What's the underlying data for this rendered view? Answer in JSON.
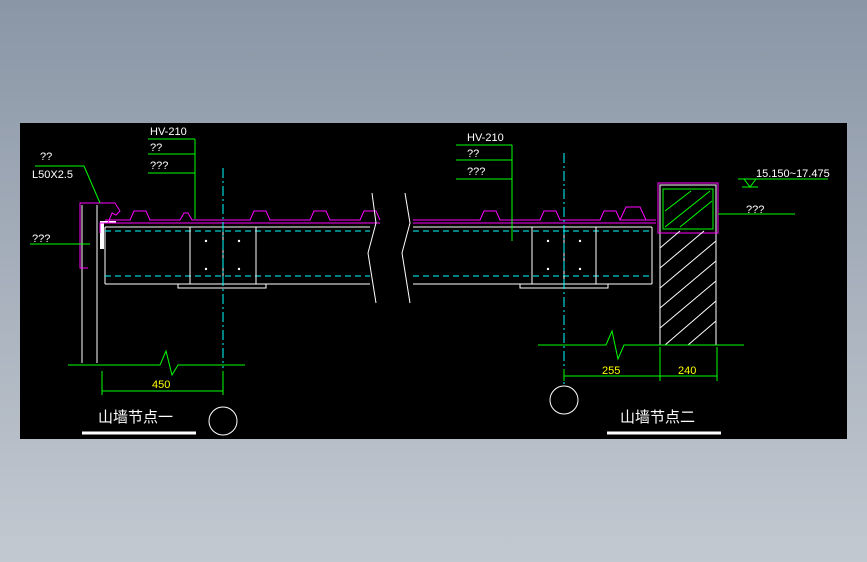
{
  "drawing": {
    "detail_one": {
      "title": "山墙节点一",
      "label_q2": "??",
      "label_angle": "L50X2.5",
      "label_hv": "HV-210",
      "label_q2b": "??",
      "label_q3": "???",
      "label_q3_left": "???",
      "dim_450": "450"
    },
    "detail_two": {
      "title": "山墙节点二",
      "label_hv": "HV-210",
      "label_q2": "??",
      "label_q3": "???",
      "label_elev": "15.150~17.475",
      "label_q3_right": "???",
      "dim_255": "255",
      "dim_240": "240"
    }
  },
  "colors": {
    "background": "#000000",
    "green": "#00ff00",
    "magenta": "#ff00ff",
    "cyan": "#00ffff",
    "white": "#ffffff",
    "yellow": "#ffff00"
  }
}
